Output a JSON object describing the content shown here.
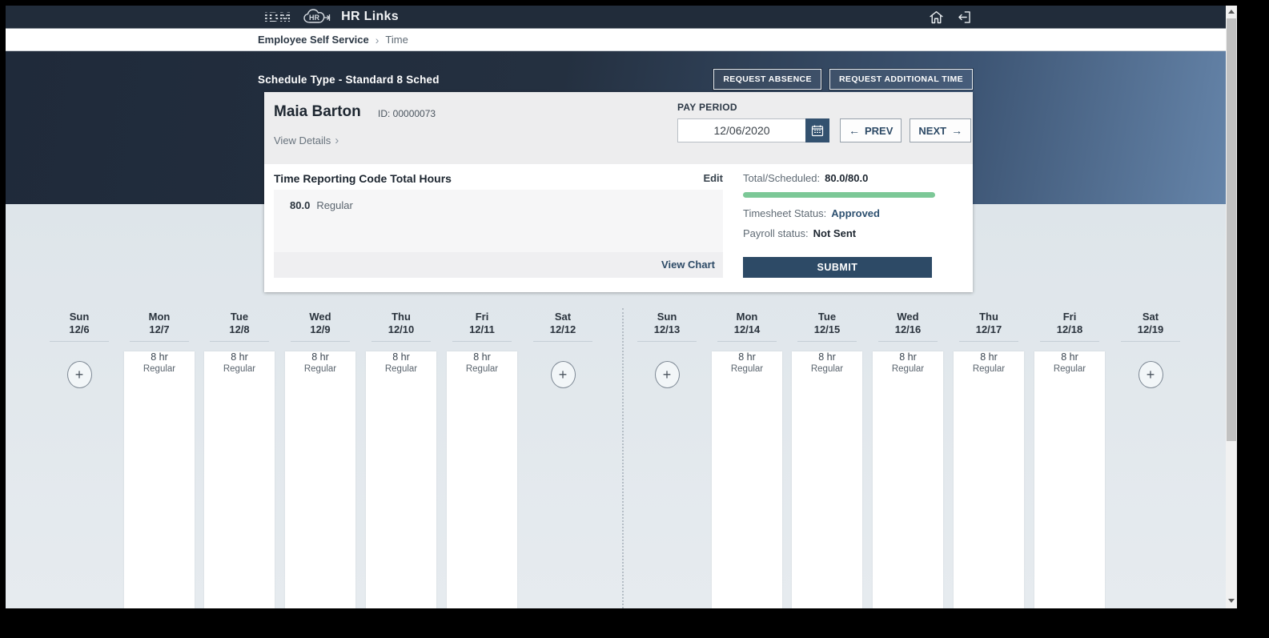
{
  "app": {
    "brand_ibm": "IBM",
    "logo_hr": "HR",
    "brand_product": "HR Links"
  },
  "breadcrumb": {
    "root": "Employee Self Service",
    "current": "Time"
  },
  "banner": {
    "schedule_type": "Schedule Type -  Standard 8 Sched",
    "request_absence": "REQUEST ABSENCE",
    "request_additional_time": "REQUEST ADDITIONAL TIME"
  },
  "employee": {
    "name": "Maia Barton",
    "id_text": "ID: 00000073",
    "view_details": "View Details"
  },
  "pay_period": {
    "label": "PAY PERIOD",
    "date": "12/06/2020",
    "prev": "PREV",
    "next": "NEXT"
  },
  "time_reporting": {
    "title": "Time Reporting Code Total Hours",
    "edit": "Edit",
    "entries": [
      {
        "hours": "80.0",
        "code": "Regular"
      }
    ],
    "view_chart": "View Chart"
  },
  "summary": {
    "total_label": "Total/Scheduled:",
    "total_value": "80.0/80.0",
    "progress_percent": 100,
    "progress_color": "#7cc897",
    "timesheet_label": "Timesheet Status:",
    "timesheet_value": "Approved",
    "timesheet_value_color": "#2d5070",
    "payroll_label": "Payroll status:",
    "payroll_value": "Not Sent",
    "submit": "SUBMIT",
    "accent_color": "#2d4a66"
  },
  "icons": {
    "plus": "+",
    "prev_arrow": "←",
    "next_arrow": "→",
    "breadcrumb_chevron": "›",
    "view_details_chevron": "›"
  },
  "calendar": {
    "days": [
      {
        "day": "Sun",
        "date": "12/6"
      },
      {
        "day": "Mon",
        "date": "12/7",
        "entry": {
          "hours": "8 hr",
          "code": "Regular"
        }
      },
      {
        "day": "Tue",
        "date": "12/8",
        "entry": {
          "hours": "8 hr",
          "code": "Regular"
        }
      },
      {
        "day": "Wed",
        "date": "12/9",
        "entry": {
          "hours": "8 hr",
          "code": "Regular"
        }
      },
      {
        "day": "Thu",
        "date": "12/10",
        "entry": {
          "hours": "8 hr",
          "code": "Regular"
        }
      },
      {
        "day": "Fri",
        "date": "12/11",
        "entry": {
          "hours": "8 hr",
          "code": "Regular"
        }
      },
      {
        "day": "Sat",
        "date": "12/12"
      },
      {
        "day": "Sun",
        "date": "12/13"
      },
      {
        "day": "Mon",
        "date": "12/14",
        "entry": {
          "hours": "8 hr",
          "code": "Regular"
        }
      },
      {
        "day": "Tue",
        "date": "12/15",
        "entry": {
          "hours": "8 hr",
          "code": "Regular"
        }
      },
      {
        "day": "Wed",
        "date": "12/16",
        "entry": {
          "hours": "8 hr",
          "code": "Regular"
        }
      },
      {
        "day": "Thu",
        "date": "12/17",
        "entry": {
          "hours": "8 hr",
          "code": "Regular"
        }
      },
      {
        "day": "Fri",
        "date": "12/18",
        "entry": {
          "hours": "8 hr",
          "code": "Regular"
        }
      },
      {
        "day": "Sat",
        "date": "12/19"
      }
    ]
  }
}
